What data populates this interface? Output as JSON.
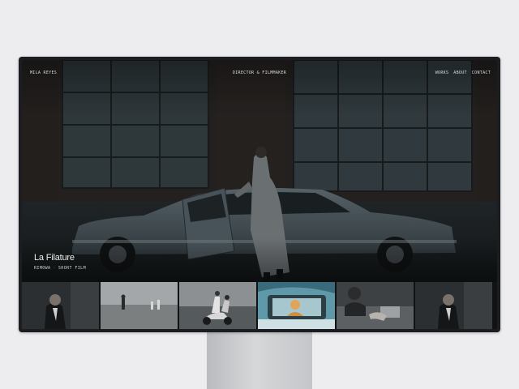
{
  "site": {
    "brand": "MILA REYES",
    "tagline": "DIRECTOR & FILMMAKER",
    "nav": [
      {
        "label": "WORKS"
      },
      {
        "label": "ABOUT"
      },
      {
        "label": "CONTACT"
      }
    ]
  },
  "featured": {
    "title": "La Filature",
    "client": "RIMOWA",
    "category": "SHORT FILM"
  },
  "thumbnails": [
    {
      "scene": "man-in-suit-portrait"
    },
    {
      "scene": "figures-on-beach"
    },
    {
      "scene": "couple-on-scooter"
    },
    {
      "scene": "woman-in-car"
    },
    {
      "scene": "hands-on-desk"
    },
    {
      "scene": "man-in-suit-portrait"
    }
  ],
  "colors": {
    "background": "#ededef",
    "bezel": "#1c1d20",
    "text": "#d8dadc"
  }
}
